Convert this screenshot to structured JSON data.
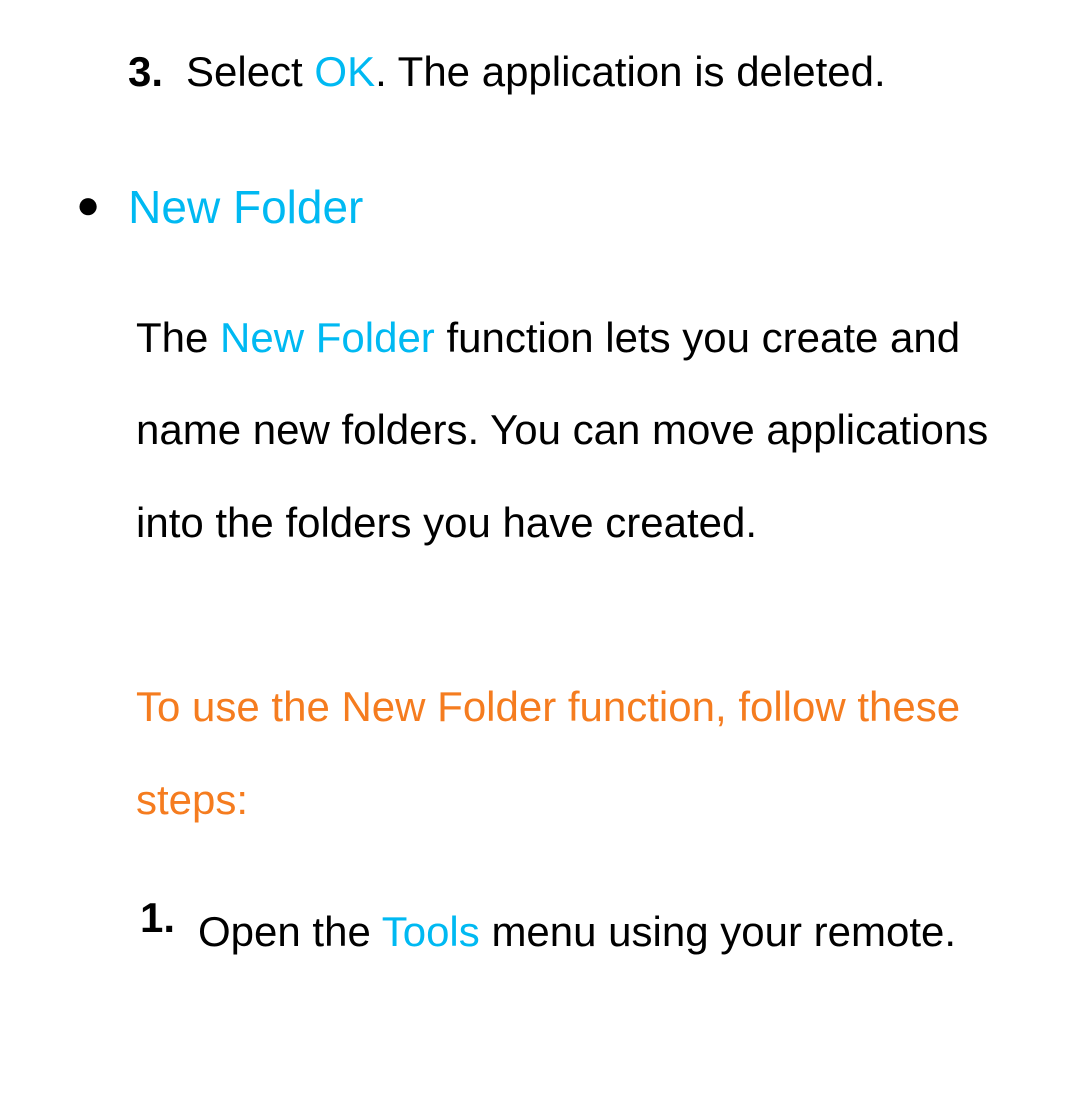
{
  "step3": {
    "num": "3.",
    "prefix": "Select ",
    "link": "OK",
    "suffix": ". The application is deleted."
  },
  "bullet": {
    "title": "New Folder"
  },
  "description": {
    "prefix": "The ",
    "link": "New Folder",
    "suffix": " function lets you create and name new folders. You can move applications into the folders you have created."
  },
  "instruction": {
    "text": "To use the New Folder function, follow these steps:"
  },
  "substep1": {
    "num": "1.",
    "prefix": "Open the ",
    "link": "Tools",
    "suffix": " menu using your remote."
  }
}
